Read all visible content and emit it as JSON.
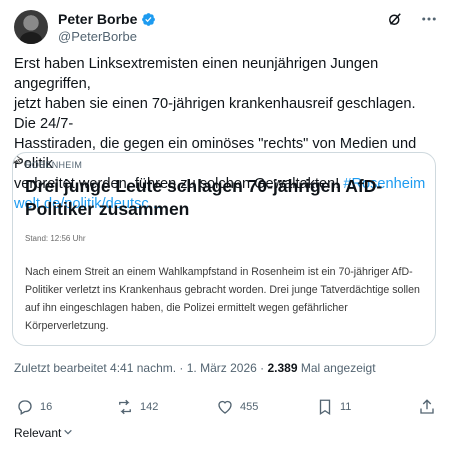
{
  "author": {
    "display_name": "Peter Borbe",
    "handle": "@PeterBorbe"
  },
  "tweet": {
    "text_lines": [
      "Erst haben Linksextremisten einen neunjährigen Jungen angegriffen,",
      "jetzt haben sie einen 70-jährigen krankenhausreif geschlagen. Die 24/7-",
      "Hasstiraden, die gegen ein ominöses \"rechts\" von Medien und Politik",
      "verbreitet werden, führen zu solchen Gewaltakten! "
    ],
    "hashtag": "#Rosenheim",
    "link": "welt.de/politik/deutsc..."
  },
  "card": {
    "source_label": "ROSENHEIM",
    "title": "Drei junge Leute schlagen 70-jährigen AfD-Politiker zusammen",
    "stand": "Stand: 12:56 Uhr",
    "body": "Nach einem Streit an einem Wahlkampfstand in Rosenheim ist ein 70-jähriger AfD-Politiker verletzt ins Krankenhaus gebracht worden. Drei junge Tatverdächtige sollen auf ihn eingeschlagen haben, die Polizei ermittelt wegen gefährlicher Körperverletzung."
  },
  "meta": {
    "edited": "Zuletzt bearbeitet 4:41 nachm. · 1. März 2026 · ",
    "views_count": "2.389",
    "views_label": " Mal angezeigt"
  },
  "actions": {
    "replies": "16",
    "reposts": "142",
    "likes": "455",
    "bookmarks": "11"
  },
  "sort": {
    "label": "Relevant"
  },
  "colors": {
    "link": "#1d9bf0",
    "verified": "#1d9bf0",
    "muted": "#536471"
  }
}
